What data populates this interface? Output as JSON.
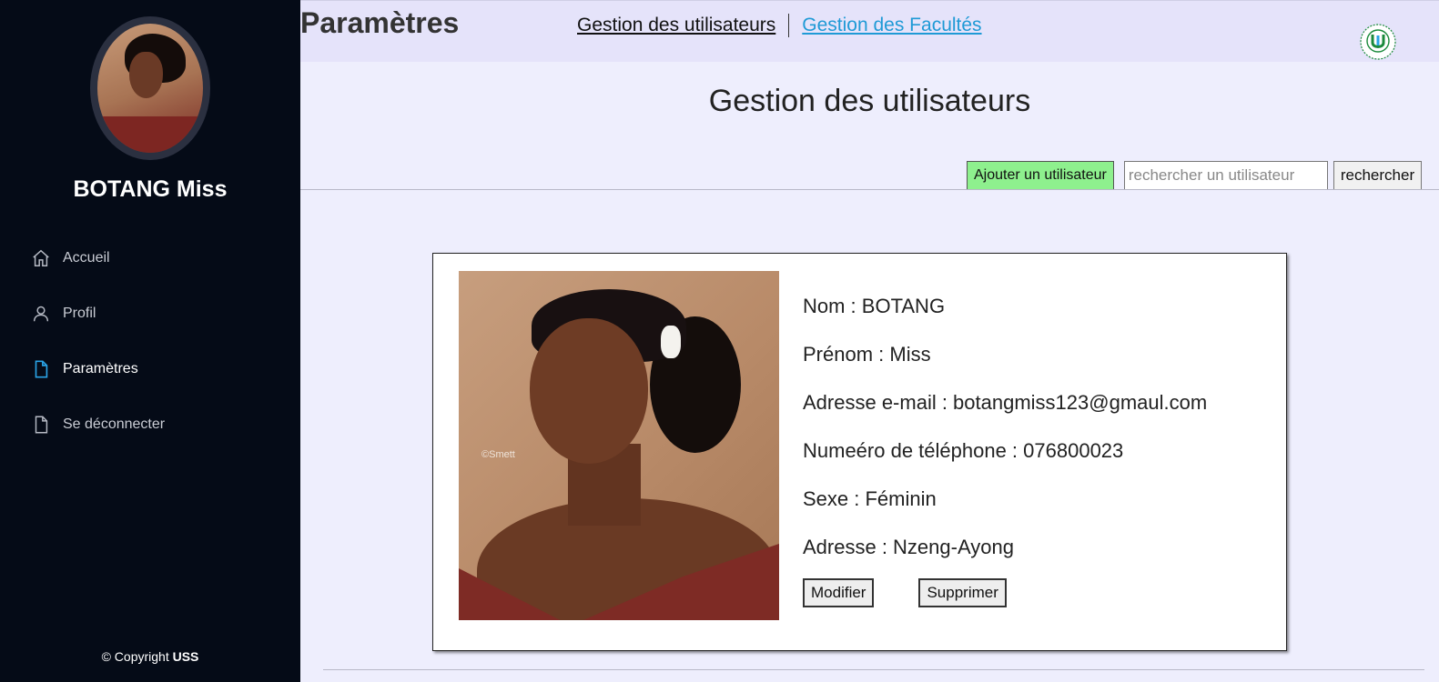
{
  "sidebar": {
    "user_name": "BOTANG Miss",
    "items": [
      {
        "label": "Accueil",
        "icon": "home-icon"
      },
      {
        "label": "Profil",
        "icon": "user-icon"
      },
      {
        "label": "Paramètres",
        "icon": "document-icon",
        "active": true
      },
      {
        "label": "Se déconnecter",
        "icon": "document-icon"
      }
    ],
    "copyright_prefix": "© Copyright",
    "copyright_brand": "USS"
  },
  "header": {
    "title": "Paramètres",
    "links": [
      "Gestion des utilisateurs",
      "Gestion des Facultés"
    ]
  },
  "main": {
    "section_title": "Gestion des utilisateurs",
    "add_button": "Ajouter un utilisateur",
    "search_placeholder": "rechercher un utilisateur",
    "search_button": "rechercher"
  },
  "user_card": {
    "photo_credit": "©Smett",
    "fields": [
      "Nom : BOTANG",
      "Prénom : Miss",
      "Adresse e-mail : botangmiss123@gmaul.com",
      "Numeéro de téléphone : 076800023",
      "Sexe : Féminin",
      "Adresse : Nzeng-Ayong"
    ],
    "edit_button": "Modifier",
    "delete_button": "Supprimer"
  },
  "colors": {
    "sidebar_bg": "#050b17",
    "topbar_bg": "#e5e3fa",
    "page_bg": "#eeeefd",
    "accent_link": "#1f9ad6",
    "add_button_bg": "#8ef08e",
    "logo_green": "#1b8a3c"
  }
}
